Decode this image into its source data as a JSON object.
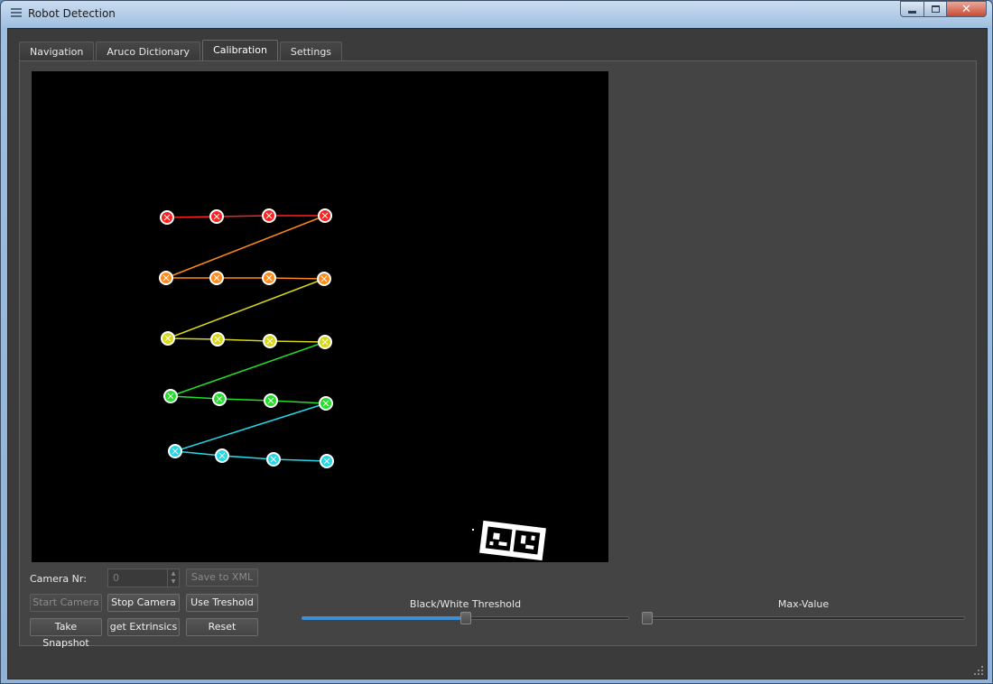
{
  "window": {
    "title": "Robot Detection",
    "controls": {
      "minimize": "minimize-icon",
      "maximize": "maximize-icon",
      "close": "close-icon"
    }
  },
  "tabs": [
    {
      "label": "Navigation",
      "active": false
    },
    {
      "label": "Aruco Dictionary",
      "active": false
    },
    {
      "label": "Calibration",
      "active": true
    },
    {
      "label": "Settings",
      "active": false
    }
  ],
  "calibration": {
    "camera_nr_label": "Camera Nr:",
    "camera_nr_value": "0",
    "buttons": {
      "save_to_xml": "Save to XML",
      "start_camera": "Start Camera",
      "stop_camera": "Stop Camera",
      "use_threshold": "Use Treshold",
      "take_snapshot": "Take Snapshot",
      "get_extrinsics": "get Extrinsics",
      "reset": "Reset"
    },
    "bw_threshold_label": "Black/White Threshold",
    "bw_threshold_level": 0.5,
    "max_value_label": "Max-Value",
    "max_value_level": 0.0,
    "pattern_colors": [
      "#ff2020",
      "#ff8a1a",
      "#d8d818",
      "#22e02a",
      "#22d8e8"
    ]
  }
}
